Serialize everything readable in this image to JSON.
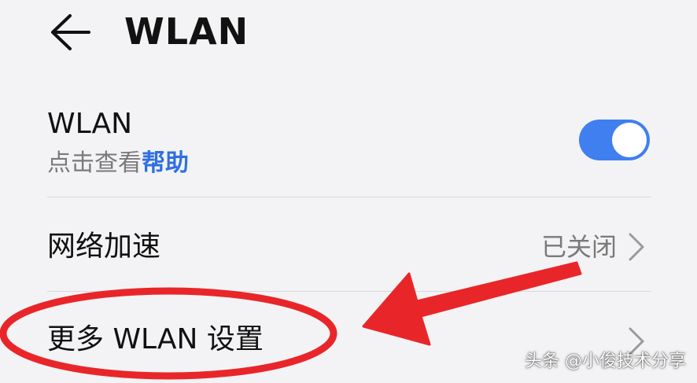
{
  "header": {
    "title": "WLAN",
    "back_icon": "arrow-left-icon"
  },
  "wlan_row": {
    "title": "WLAN",
    "subtitle_prefix": "点击查看",
    "help_link": "帮助",
    "toggle_on": true
  },
  "accel_row": {
    "label": "网络加速",
    "value": "已关闭",
    "chevron_icon": "chevron-right-icon"
  },
  "more_row": {
    "label": "更多 WLAN 设置",
    "chevron_icon": "chevron-right-icon"
  },
  "watermark": {
    "text": "头条 @小俊技术分享"
  },
  "colors": {
    "background": "#f3f3f5",
    "accent": "#3f7ff0",
    "link": "#2f6fe0",
    "secondary_text": "#7a7a7a",
    "annotation_red": "#e8262a"
  }
}
